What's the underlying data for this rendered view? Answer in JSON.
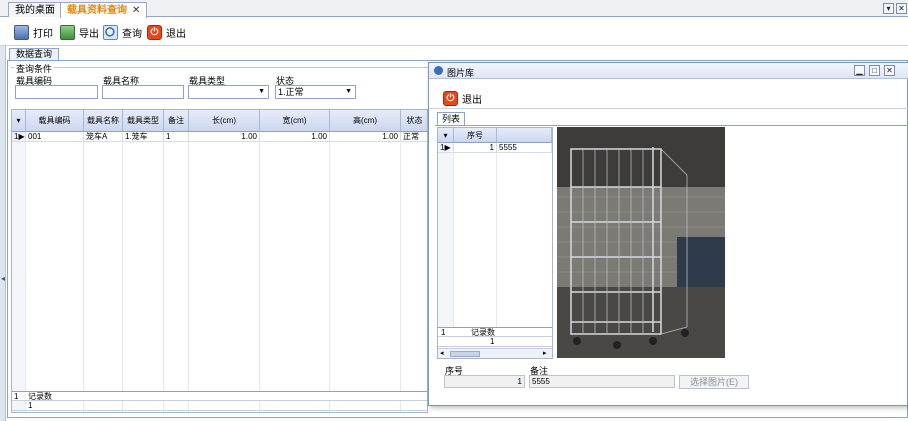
{
  "tabs": [
    {
      "label": "我的桌面",
      "active": false
    },
    {
      "label": "载具资料查询",
      "active": true
    }
  ],
  "tab_close": "✕",
  "window_controls": {
    "dropdown": "▾",
    "close": "✕"
  },
  "toolbar": {
    "print_label": "打印",
    "export_label": "导出",
    "query_label": "查询",
    "exit_label": "退出"
  },
  "query_tab_label": "数据查询",
  "criteria": {
    "group_title": "查询条件",
    "code_label": "载具编码",
    "code_value": "",
    "name_label": "载具名称",
    "name_value": "",
    "type_label": "载具类型",
    "type_value": "",
    "status_label": "状态",
    "status_value": "1.正常"
  },
  "grid": {
    "headers": [
      "载具编码",
      "载具名称",
      "载具类型",
      "备注",
      "长(cm)",
      "宽(cm)",
      "高(cm)",
      "状态"
    ],
    "rows": [
      {
        "row_no": "1",
        "code": "001",
        "name": "笼车A",
        "type": "1.笼车",
        "note": "1",
        "length": "1.00",
        "width": "1.00",
        "height": "1.00",
        "status": "正常"
      }
    ],
    "footer_label": "记录数",
    "footer_row_no": "1",
    "footer_count": "1"
  },
  "image_window": {
    "title": "图片库",
    "exit_label": "退出",
    "list_tab_label": "列表",
    "grid_header": "序号",
    "rows": [
      {
        "row_no": "1",
        "seq": "1",
        "note": "5555"
      }
    ],
    "footer_label": "记录数",
    "footer_row_no": "1",
    "footer_count": "1",
    "seq_label": "序号",
    "seq_value": "1",
    "note_label": "备注",
    "note_value": "5555",
    "pick_button": "选择图片(E)"
  },
  "colors": {
    "accent_tab": "#e8870f",
    "exit_icon": "#e8471c",
    "header_blue": "#ccd6f0"
  }
}
